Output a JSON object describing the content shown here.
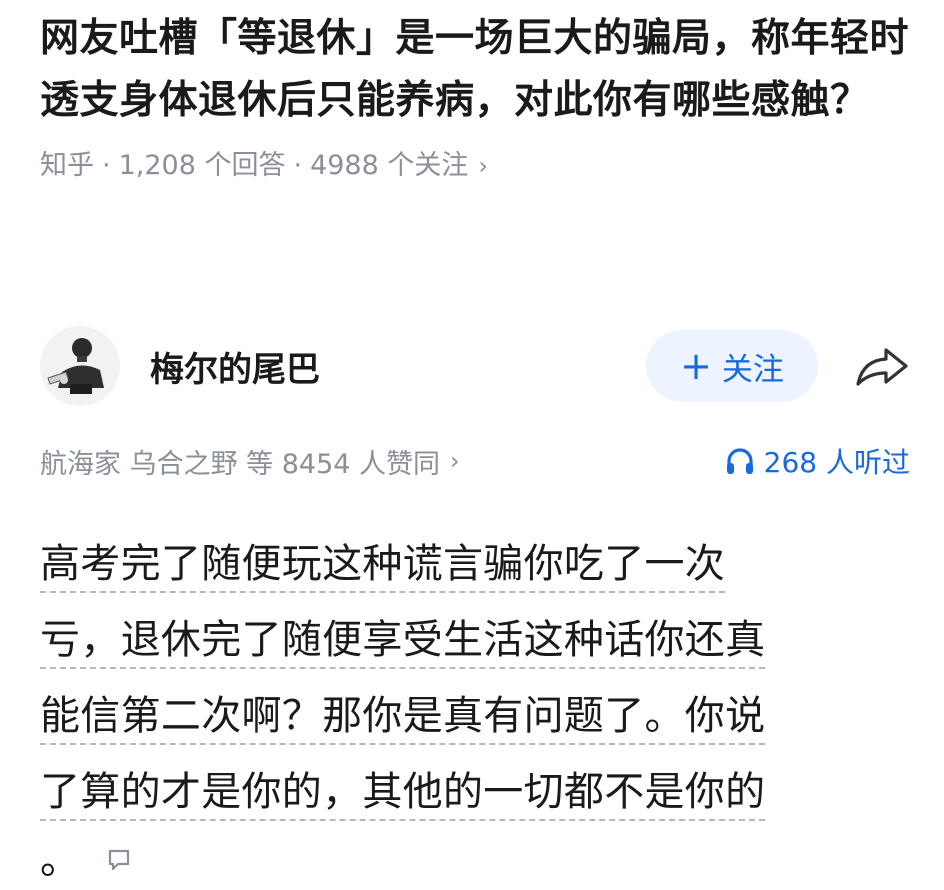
{
  "question": {
    "title": "网友吐槽「等退休」是一场巨大的骗局，称年轻时透支身体退休后只能养病，对此你有哪些感触？",
    "source": "知乎",
    "answers": "1,208 个回答",
    "followers": "4988 个关注",
    "chevron": "›"
  },
  "author": {
    "name": "梅尔的尾巴",
    "follow_label": "关注",
    "follow_icon": "+",
    "avatar_icon": "avatar",
    "share_icon": "share-icon"
  },
  "stats": {
    "endorsement": "航海家 乌合之野 等 8454 人赞同",
    "chevron": "›",
    "listen_count": "268 人听过",
    "headphone_icon": "headphone-icon"
  },
  "answer": {
    "lines": [
      "高考完了随便玩这种谎言骗你吃了一次",
      "亏，退休完了随便享受生活这种话你还真",
      "能信第二次啊？那你是真有问题了。你说",
      "了算的才是你的，其他的一切都不是你的"
    ],
    "tail": "。",
    "comment_icon": "comment-icon"
  },
  "colors": {
    "accent": "#1769e0",
    "follow_bg": "#eef4ff",
    "meta": "#8a8f99",
    "text": "#1a1a1a"
  }
}
